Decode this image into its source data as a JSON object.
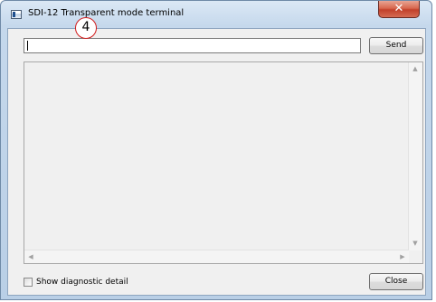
{
  "window": {
    "title": "SDI-12 Transparent mode terminal",
    "close_glyph": "✕"
  },
  "command": {
    "value": "",
    "send_label": "Send"
  },
  "annotation": {
    "number": "4"
  },
  "output": {
    "text": ""
  },
  "footer": {
    "diagnostic_label": "Show diagnostic detail",
    "diagnostic_checked": false,
    "close_label": "Close"
  },
  "icons": {
    "app": "window-app-icon",
    "close": "close-icon"
  },
  "colors": {
    "titlebar": "#c5d8ec",
    "close_button": "#c2402a",
    "annotation_ring": "#d11b1b",
    "panel": "#f0f0f0"
  }
}
